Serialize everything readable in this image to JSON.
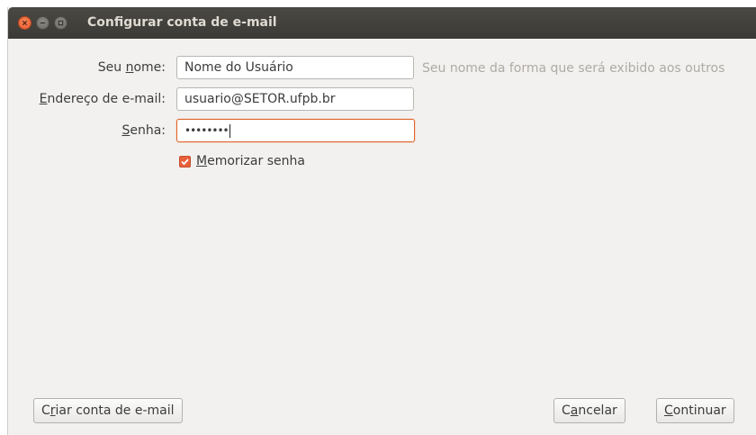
{
  "window": {
    "title": "Configurar conta de e-mail",
    "controls": [
      "close-icon",
      "minimize-icon",
      "maximize-icon"
    ]
  },
  "form": {
    "name": {
      "label_prefix": "Seu ",
      "label_accel": "n",
      "label_suffix": "ome:",
      "value": "Nome do Usuário",
      "hint": "Seu nome da forma que será exibido aos outros"
    },
    "email": {
      "label_accel": "E",
      "label_suffix": "ndereço de e-mail:",
      "value": "usuario@SETOR.ufpb.br"
    },
    "password": {
      "label_accel": "S",
      "label_suffix": "enha:",
      "value_masked": "••••••••"
    },
    "remember": {
      "checked": true,
      "label_accel": "M",
      "label_suffix": "emorizar senha"
    }
  },
  "buttons": {
    "create": {
      "prefix": "C",
      "accel": "r",
      "suffix": "iar conta de e-mail"
    },
    "cancel": {
      "prefix": "C",
      "accel": "a",
      "suffix": "ncelar"
    },
    "continue": {
      "accel": "C",
      "suffix": "ontinuar"
    }
  },
  "colors": {
    "titlebar": "#3b3a36",
    "accent": "#e0642a",
    "close_button": "#e8572a",
    "background": "#f2f1f0"
  }
}
